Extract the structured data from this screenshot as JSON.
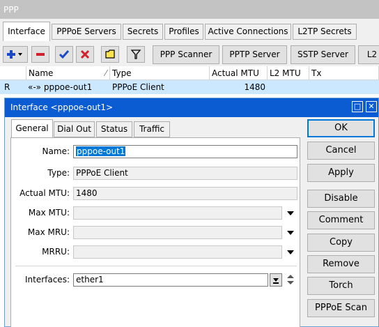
{
  "window": {
    "title": "PPP"
  },
  "tabs": [
    {
      "label": "Interface",
      "active": true
    },
    {
      "label": "PPPoE Servers"
    },
    {
      "label": "Secrets"
    },
    {
      "label": "Profiles"
    },
    {
      "label": "Active Connections"
    },
    {
      "label": "L2TP Secrets"
    }
  ],
  "toolbar": {
    "icons": [
      "add-plus-icon",
      "remove-minus-icon",
      "enable-check-icon",
      "disable-x-icon",
      "comment-icon",
      "filter-icon"
    ],
    "buttons": [
      "PPP Scanner",
      "PPTP Server",
      "SSTP Server",
      "L2"
    ]
  },
  "list": {
    "columns": [
      "Name",
      "Type",
      "Actual MTU",
      "L2 MTU",
      "Tx"
    ],
    "rows": [
      {
        "flag": "R",
        "name": "«-» pppoe-out1",
        "type": "PPPoE Client",
        "actual_mtu": "1480",
        "l2_mtu": "",
        "tx": ""
      }
    ]
  },
  "dialog": {
    "title": "Interface <pppoe-out1>",
    "tabs": [
      "General",
      "Dial Out",
      "Status",
      "Traffic"
    ],
    "active_tab": "General",
    "fields": {
      "name_label": "Name:",
      "name_value": "pppoe-out1",
      "type_label": "Type:",
      "type_value": "PPPoE Client",
      "actual_mtu_label": "Actual MTU:",
      "actual_mtu_value": "1480",
      "max_mtu_label": "Max MTU:",
      "max_mtu_value": "",
      "max_mru_label": "Max MRU:",
      "max_mru_value": "",
      "mrru_label": "MRRU:",
      "mrru_value": "",
      "interfaces_label": "Interfaces:",
      "interfaces_value": "ether1"
    },
    "buttons": [
      "OK",
      "Cancel",
      "Apply",
      "Disable",
      "Comment",
      "Copy",
      "Remove",
      "Torch",
      "PPPoE Scan"
    ]
  }
}
